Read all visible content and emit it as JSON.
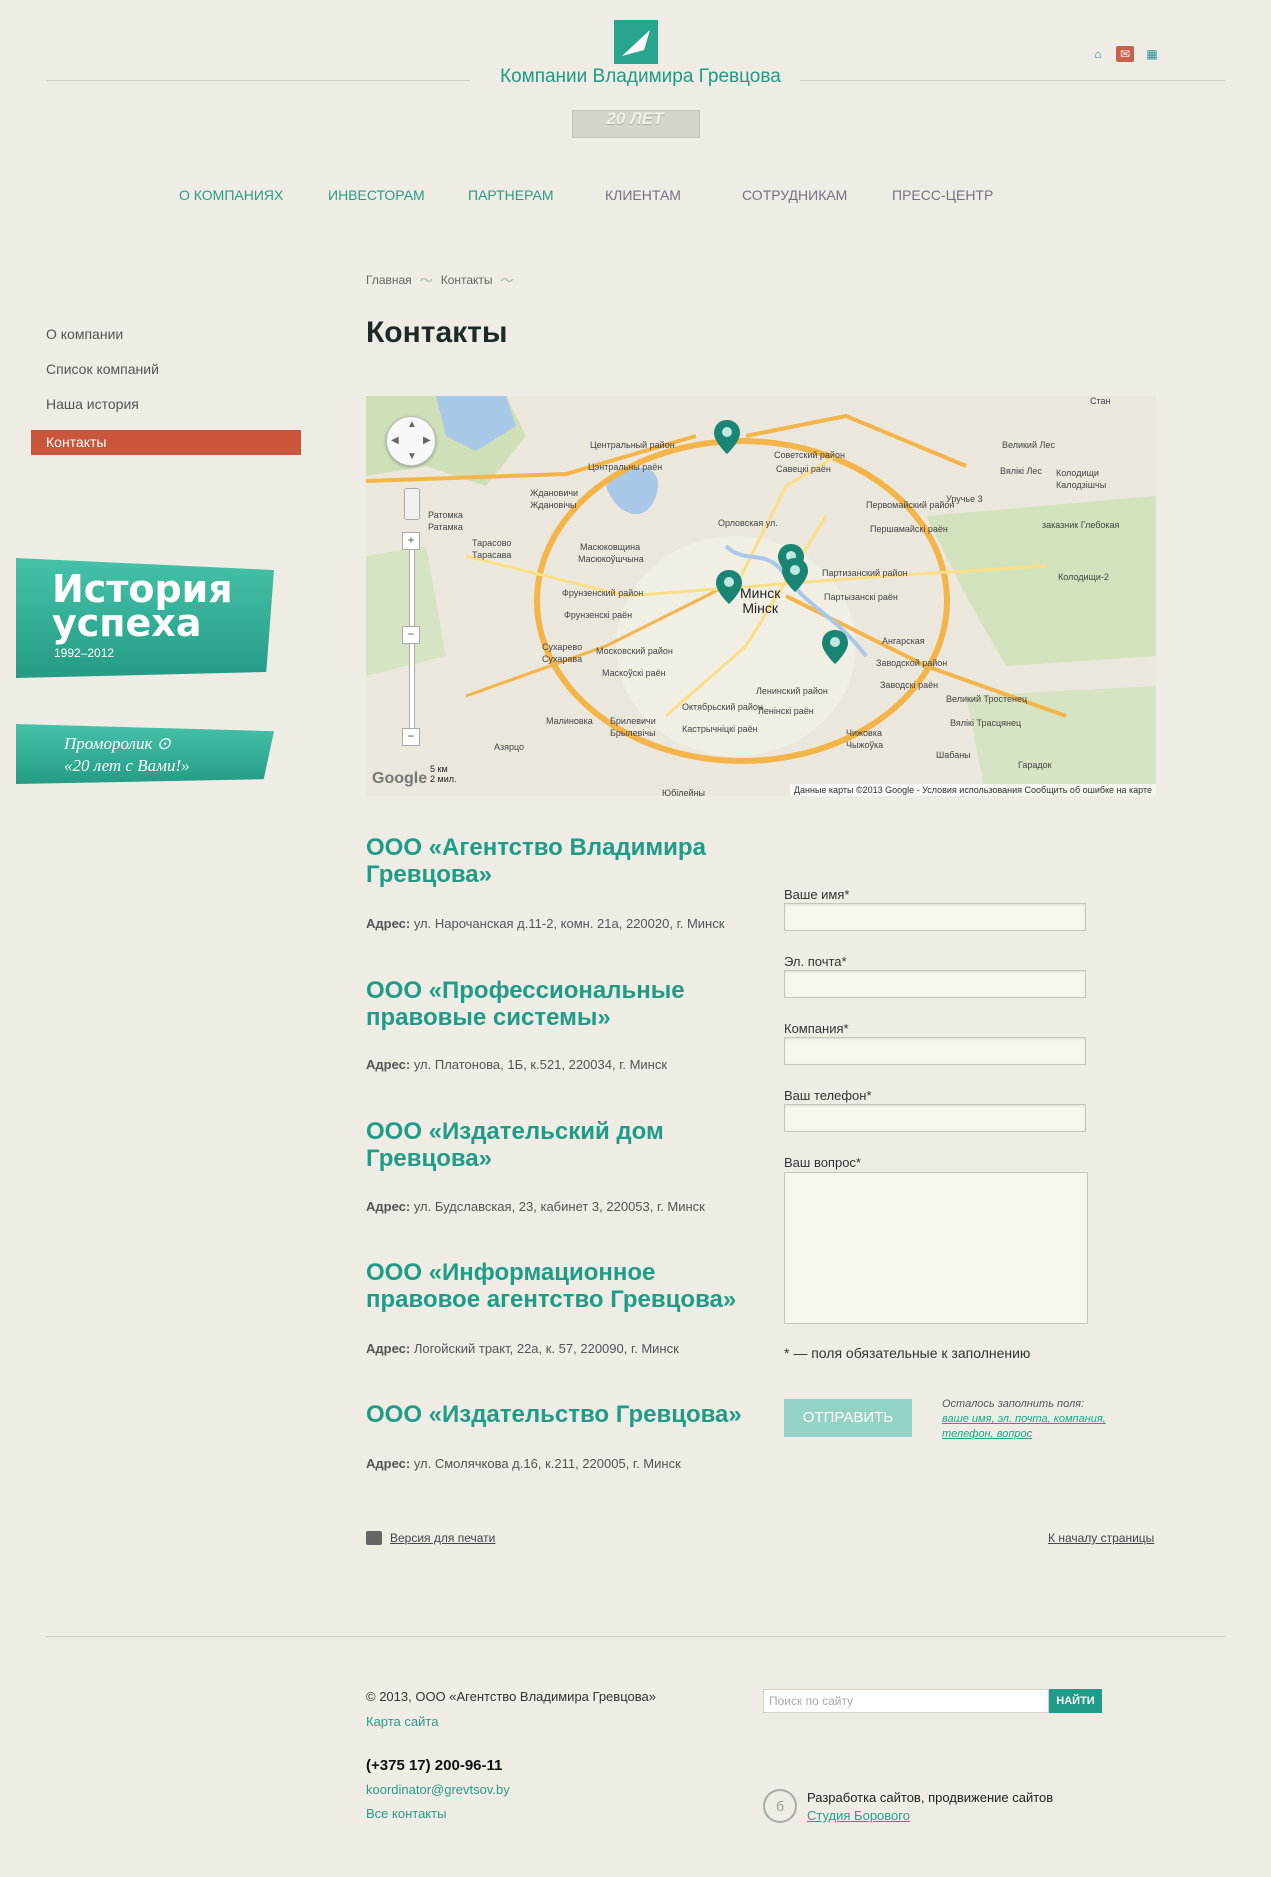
{
  "header": {
    "logo_text": "Компании Владимира Гревцова",
    "anniversary": "20 ЛЕТ",
    "icons": [
      "home-icon",
      "mail-icon",
      "sitemap-icon"
    ]
  },
  "nav": [
    {
      "label": "О КОМПАНИЯХ"
    },
    {
      "label": "ИНВЕСТОРАМ"
    },
    {
      "label": "ПАРТНЕРАМ"
    },
    {
      "label": "КЛИЕНТАМ"
    },
    {
      "label": "СОТРУДНИКАМ"
    },
    {
      "label": "ПРЕСС-ЦЕНТР"
    }
  ],
  "breadcrumb": [
    "Главная",
    "Контакты"
  ],
  "page_title": "Контакты",
  "sidebar": {
    "items": [
      "О компании",
      "Список компаний",
      "Наша история",
      "Контакты"
    ],
    "ribbon_history": {
      "line1": "История",
      "line2": "успеха",
      "years": "1992–2012"
    },
    "ribbon_promo": {
      "line1": "Проморолик",
      "line2": "«20 лет с Вами!»"
    }
  },
  "map": {
    "city_label_ru": "Минск",
    "city_label_by": "Мінск",
    "labels": [
      "Центральный район",
      "Цэнтральны раён",
      "Советский район",
      "Савецкі раён",
      "Уручье 3",
      "Первомайский район",
      "Першамайскі раён",
      "Партизанский район",
      "Партызанскі раён",
      "Московский район",
      "Маскоўскі раён",
      "Фрунзенский район",
      "Фрунзенскі раён",
      "Ленинский район",
      "Ленінскі раён",
      "Заводской район",
      "Заводскі раён",
      "Октябрьский район",
      "Кастрычніцкі раён",
      "Ангарская",
      "Чижовка",
      "Чыжоўка",
      "Малиновка",
      "Брилевичи",
      "Брылевічы",
      "Сухарево",
      "Сухарава",
      "Масюковщина",
      "Масюкоўшчына",
      "Тарасово",
      "Тарасава",
      "Ратомка",
      "Ратамка",
      "Ждановичи",
      "Жданoвічы",
      "Великий Лес",
      "Вялікі Лес",
      "Колодищи",
      "Калодзішчы",
      "заказник Глебокая",
      "Колодищи-2",
      "Великий Тростенец",
      "Вялікі Трасцянец",
      "Шабаны",
      "Гарадок",
      "Азярцо",
      "Стан",
      "Юбілейны",
      "Орловская ул."
    ],
    "scale_km": "5 км",
    "scale_mi": "2 мил.",
    "google": "Google",
    "attribution": "Данные карты ©2013 Google - Условия использования  Сообщить об ошибке на карте"
  },
  "companies": [
    {
      "name": "ООО «Агентство Владимира Гревцова»",
      "addr_label": "Адрес:",
      "address": "ул. Нарочанская д.11-2, комн. 21а, 220020, г. Минск"
    },
    {
      "name": "ООО «Профессиональные правовые системы»",
      "addr_label": "Адрес:",
      "address": "ул. Платонова, 1Б, к.521, 220034, г. Минск"
    },
    {
      "name": "ООО «Издательский дом Гревцова»",
      "addr_label": "Адрес:",
      "address": "ул. Будславская, 23, кабинет 3, 220053, г. Минск"
    },
    {
      "name": "ООО «Информационное правовое агентство Гревцова»",
      "addr_label": "Адрес:",
      "address": "Логойский тракт, 22а, к. 57, 220090, г. Минск"
    },
    {
      "name": "ООО «Издательство Гревцова»",
      "addr_label": "Адрес:",
      "address": "ул. Смолячкова д.16, к.211, 220005, г. Минск"
    }
  ],
  "form": {
    "name_label": "Ваше имя*",
    "email_label": "Эл. почта*",
    "company_label": "Компания*",
    "phone_label": "Ваш телефон*",
    "question_label": "Ваш вопрос*",
    "required_note": "* — поля обязательные к заполнению",
    "submit": "ОТПРАВИТЬ",
    "remaining_label": "Осталось заполнить поля:",
    "remaining_fields": "ваше имя, эл. почта, компания, телефон, вопрос"
  },
  "print_link": "Версия для печати",
  "to_top": "К началу страницы",
  "footer": {
    "copyright": "© 2013, ООО «Агентство Владимира Гревцова»",
    "sitemap": "Карта сайта",
    "phone": "(+375 17) 200-96-11",
    "email": "koordinator@grevtsov.by",
    "all_contacts": "Все контакты",
    "search_placeholder": "Поиск по сайту",
    "search_button": "НАЙТИ",
    "dev_text": "Разработка сайтов, продвижение сайтов",
    "dev_link": "Студия Борового"
  },
  "colors": {
    "background": "#eeece4",
    "accent": "#1f9c87",
    "active": "#c9553a",
    "submit": "#93d3c6"
  }
}
